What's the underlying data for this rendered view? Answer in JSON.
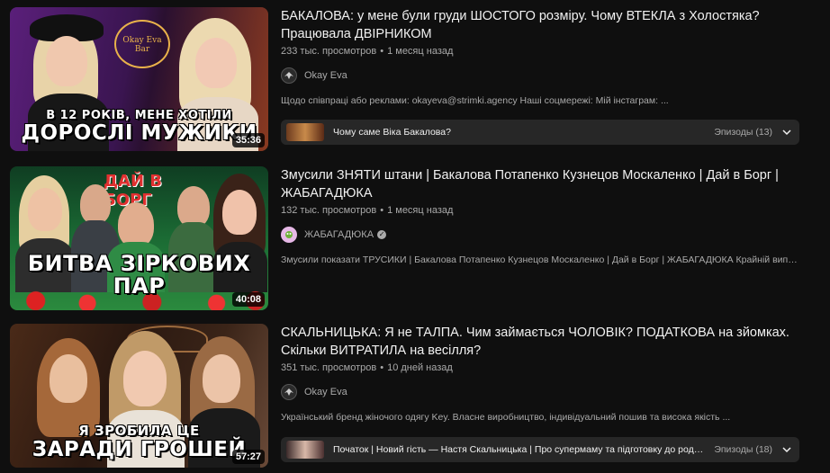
{
  "videos": [
    {
      "title": "БАКАЛОВА: у мене були груди ШОСТОГО розміру. Чому ВТЕКЛА з Холостяка? Працювала ДВІРНИКОМ",
      "views": "233 тыс. просмотров",
      "age": "1 месяц назад",
      "channel": "Okay Eva",
      "verified": false,
      "description": "Щодо співпраці або реклами: okayeva@strimki.agency Наші соцмережі: Мій інстаграм: ...",
      "duration": "35:36",
      "thumb_headline_1": "В 12 РОКІВ, МЕНЕ ХОТІЛИ",
      "thumb_headline_2": "ДОРОСЛІ МУЖИКИ",
      "thumb_sign": "Okay Eva Bar",
      "episode_title": "Чому саме Віка Бакалова?",
      "episode_count": "Эпизоды (13)"
    },
    {
      "title": "Змусили ЗНЯТИ штани | Бакалова Потапенко Кузнецов Москаленко | Дай в Борг | ЖАБАГАДЮКА",
      "views": "132 тыс. просмотров",
      "age": "1 месяц назад",
      "channel": "ЖАБАГАДЮКА",
      "verified": true,
      "description": "Змусили показати ТРУСИКИ | Бакалова Потапенко Кузнецов Москаленко | Дай в Борг | ЖАБАГАДЮКА Крайній випуск Дай в ...",
      "duration": "40:08",
      "thumb_headline_1": "БИТВА ЗІРКОВИХ ПАР",
      "thumb_sign": "ДАЙ В БОРГ"
    },
    {
      "title": "СКАЛЬНИЦЬКА: Я не ТАЛПА. Чим займається ЧОЛОВІК? ПОДАТКОВА на зйомках. Скільки ВИТРАТИЛА на весілля?",
      "views": "351 тыс. просмотров",
      "age": "10 дней назад",
      "channel": "Okay Eva",
      "verified": false,
      "description": "Український бренд жіночого одягу Key. Власне виробництво, індивідуальний пошив та висока якість ...",
      "duration": "57:27",
      "thumb_headline_1": "Я ЗРОБИЛА ЦЕ",
      "thumb_headline_2": "ЗАРАДИ ГРОШЕЙ",
      "episode_title": "Початок | Новий гість — Настя Скальницька | Про супермаму та підготовку до родів | Чом...",
      "episode_count": "Эпизоды (18)"
    }
  ],
  "icons": {
    "chevron": "chevron-down-icon",
    "verified": "check-badge-icon"
  },
  "colors": {
    "background": "#0f0f0f",
    "panel": "#272727",
    "secondary_text": "#aaaaaa",
    "accent_purple": "#7a2ea8",
    "accent_green": "#1f9d3c"
  }
}
